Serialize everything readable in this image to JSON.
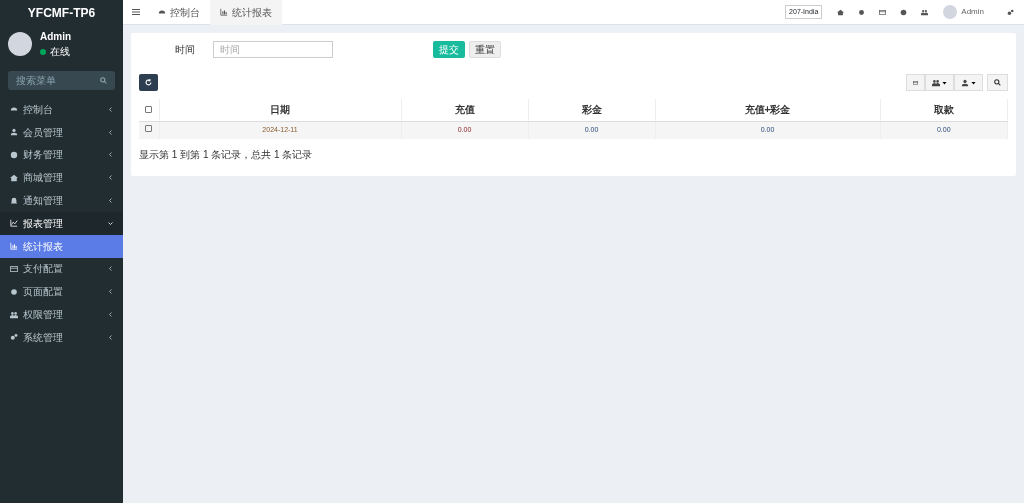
{
  "sidebar": {
    "logo": "YFCMF-TP6",
    "user": {
      "name": "Admin",
      "status": "在线"
    },
    "search": {
      "placeholder": "搜索菜单"
    },
    "items": [
      {
        "label": "控制台",
        "expanded": false
      },
      {
        "label": "会员管理",
        "expanded": false
      },
      {
        "label": "财务管理",
        "expanded": false
      },
      {
        "label": "商城管理",
        "expanded": false
      },
      {
        "label": "通知管理",
        "expanded": false
      },
      {
        "label": "报表管理",
        "expanded": true,
        "children": [
          {
            "label": "统计报表",
            "selected": true
          }
        ]
      },
      {
        "label": "支付配置",
        "expanded": false
      },
      {
        "label": "页面配置",
        "expanded": false
      },
      {
        "label": "权限管理",
        "expanded": false
      },
      {
        "label": "系统管理",
        "expanded": false
      }
    ]
  },
  "topbar": {
    "tabs": [
      {
        "label": "控制台",
        "selected": false
      },
      {
        "label": "统计报表",
        "selected": true
      }
    ],
    "server": "207-India",
    "user": "Admin"
  },
  "filter": {
    "label": "时间",
    "placeholder": "时间",
    "submit": "提交",
    "reset": "重置"
  },
  "table": {
    "select_all_checked": false,
    "columns": [
      "日期",
      "充值",
      "彩金",
      "充值+彩金",
      "取款"
    ],
    "rows": [
      {
        "checked": false,
        "cells": [
          "2024-12-11",
          "0.00",
          "0.00",
          "0.00",
          "0.00"
        ]
      }
    ],
    "summary": "显示第 1 到第 1 条记录，总共 1 条记录"
  }
}
